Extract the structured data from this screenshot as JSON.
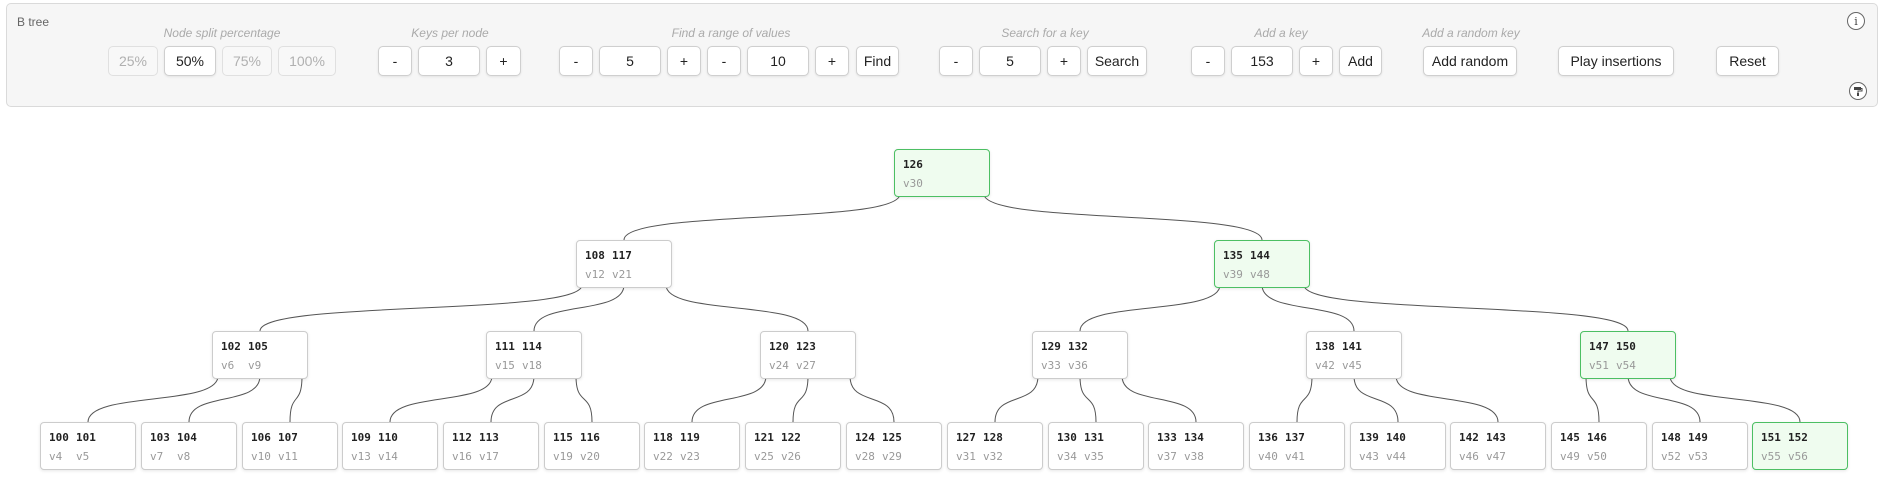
{
  "app": {
    "title": "B tree"
  },
  "colors": {
    "highlight_bg": "#effcef",
    "highlight_border": "#4cbf63",
    "edge": "#555555"
  },
  "controls": {
    "split": {
      "label": "Node split percentage",
      "options": [
        "25%",
        "50%",
        "75%",
        "100%"
      ],
      "selected": "50%"
    },
    "keys_per_node": {
      "label": "Keys per node",
      "minus": "-",
      "value": "3",
      "plus": "+"
    },
    "range": {
      "label": "Find a range of values",
      "from_value": "5",
      "to_value": "10",
      "minus": "-",
      "plus": "+",
      "find_label": "Find"
    },
    "search": {
      "label": "Search for a key",
      "minus": "-",
      "value": "5",
      "plus": "+",
      "button_label": "Search"
    },
    "add": {
      "label": "Add a key",
      "minus": "-",
      "value": "153",
      "plus": "+",
      "button_label": "Add"
    },
    "random": {
      "label": "Add a random key",
      "button_label": "Add random"
    },
    "play_label": "Play insertions",
    "reset_label": "Reset",
    "info_icon": "info-icon",
    "style_icon": "paint-roller-icon"
  },
  "tree": {
    "nodes": [
      {
        "id": "r",
        "keys": [
          "126"
        ],
        "values": [
          "v30"
        ],
        "highlight": true,
        "depth": 0
      },
      {
        "id": "a",
        "keys": [
          "108",
          "117"
        ],
        "values": [
          "v12",
          "v21"
        ],
        "highlight": false,
        "depth": 1
      },
      {
        "id": "b",
        "keys": [
          "135",
          "144"
        ],
        "values": [
          "v39",
          "v48"
        ],
        "highlight": true,
        "depth": 1
      },
      {
        "id": "a1",
        "keys": [
          "102",
          "105"
        ],
        "values": [
          "v6",
          "v9"
        ],
        "highlight": false,
        "depth": 2
      },
      {
        "id": "a2",
        "keys": [
          "111",
          "114"
        ],
        "values": [
          "v15",
          "v18"
        ],
        "highlight": false,
        "depth": 2
      },
      {
        "id": "a3",
        "keys": [
          "120",
          "123"
        ],
        "values": [
          "v24",
          "v27"
        ],
        "highlight": false,
        "depth": 2
      },
      {
        "id": "b1",
        "keys": [
          "129",
          "132"
        ],
        "values": [
          "v33",
          "v36"
        ],
        "highlight": false,
        "depth": 2
      },
      {
        "id": "b2",
        "keys": [
          "138",
          "141"
        ],
        "values": [
          "v42",
          "v45"
        ],
        "highlight": false,
        "depth": 2
      },
      {
        "id": "b3",
        "keys": [
          "147",
          "150"
        ],
        "values": [
          "v51",
          "v54"
        ],
        "highlight": true,
        "depth": 2
      },
      {
        "id": "l1",
        "keys": [
          "100",
          "101"
        ],
        "values": [
          "v4",
          "v5"
        ],
        "highlight": false,
        "depth": 3
      },
      {
        "id": "l2",
        "keys": [
          "103",
          "104"
        ],
        "values": [
          "v7",
          "v8"
        ],
        "highlight": false,
        "depth": 3
      },
      {
        "id": "l3",
        "keys": [
          "106",
          "107"
        ],
        "values": [
          "v10",
          "v11"
        ],
        "highlight": false,
        "depth": 3
      },
      {
        "id": "l4",
        "keys": [
          "109",
          "110"
        ],
        "values": [
          "v13",
          "v14"
        ],
        "highlight": false,
        "depth": 3
      },
      {
        "id": "l5",
        "keys": [
          "112",
          "113"
        ],
        "values": [
          "v16",
          "v17"
        ],
        "highlight": false,
        "depth": 3
      },
      {
        "id": "l6",
        "keys": [
          "115",
          "116"
        ],
        "values": [
          "v19",
          "v20"
        ],
        "highlight": false,
        "depth": 3
      },
      {
        "id": "l7",
        "keys": [
          "118",
          "119"
        ],
        "values": [
          "v22",
          "v23"
        ],
        "highlight": false,
        "depth": 3
      },
      {
        "id": "l8",
        "keys": [
          "121",
          "122"
        ],
        "values": [
          "v25",
          "v26"
        ],
        "highlight": false,
        "depth": 3
      },
      {
        "id": "l9",
        "keys": [
          "124",
          "125"
        ],
        "values": [
          "v28",
          "v29"
        ],
        "highlight": false,
        "depth": 3
      },
      {
        "id": "l10",
        "keys": [
          "127",
          "128"
        ],
        "values": [
          "v31",
          "v32"
        ],
        "highlight": false,
        "depth": 3
      },
      {
        "id": "l11",
        "keys": [
          "130",
          "131"
        ],
        "values": [
          "v34",
          "v35"
        ],
        "highlight": false,
        "depth": 3
      },
      {
        "id": "l12",
        "keys": [
          "133",
          "134"
        ],
        "values": [
          "v37",
          "v38"
        ],
        "highlight": false,
        "depth": 3
      },
      {
        "id": "l13",
        "keys": [
          "136",
          "137"
        ],
        "values": [
          "v40",
          "v41"
        ],
        "highlight": false,
        "depth": 3
      },
      {
        "id": "l14",
        "keys": [
          "139",
          "140"
        ],
        "values": [
          "v43",
          "v44"
        ],
        "highlight": false,
        "depth": 3
      },
      {
        "id": "l15",
        "keys": [
          "142",
          "143"
        ],
        "values": [
          "v46",
          "v47"
        ],
        "highlight": false,
        "depth": 3
      },
      {
        "id": "l16",
        "keys": [
          "145",
          "146"
        ],
        "values": [
          "v49",
          "v50"
        ],
        "highlight": false,
        "depth": 3
      },
      {
        "id": "l17",
        "keys": [
          "148",
          "149"
        ],
        "values": [
          "v52",
          "v53"
        ],
        "highlight": false,
        "depth": 3
      },
      {
        "id": "l18",
        "keys": [
          "151",
          "152"
        ],
        "values": [
          "v55",
          "v56"
        ],
        "highlight": true,
        "depth": 3
      }
    ],
    "edges": [
      [
        "r",
        0,
        "a"
      ],
      [
        "r",
        1,
        "b"
      ],
      [
        "a",
        0,
        "a1"
      ],
      [
        "a",
        1,
        "a2"
      ],
      [
        "a",
        2,
        "a3"
      ],
      [
        "b",
        0,
        "b1"
      ],
      [
        "b",
        1,
        "b2"
      ],
      [
        "b",
        2,
        "b3"
      ],
      [
        "a1",
        0,
        "l1"
      ],
      [
        "a1",
        1,
        "l2"
      ],
      [
        "a1",
        2,
        "l3"
      ],
      [
        "a2",
        0,
        "l4"
      ],
      [
        "a2",
        1,
        "l5"
      ],
      [
        "a2",
        2,
        "l6"
      ],
      [
        "a3",
        0,
        "l7"
      ],
      [
        "a3",
        1,
        "l8"
      ],
      [
        "a3",
        2,
        "l9"
      ],
      [
        "b1",
        0,
        "l10"
      ],
      [
        "b1",
        1,
        "l11"
      ],
      [
        "b1",
        2,
        "l12"
      ],
      [
        "b2",
        0,
        "l13"
      ],
      [
        "b2",
        1,
        "l14"
      ],
      [
        "b2",
        2,
        "l15"
      ],
      [
        "b3",
        0,
        "l16"
      ],
      [
        "b3",
        1,
        "l17"
      ],
      [
        "b3",
        2,
        "l18"
      ]
    ]
  }
}
